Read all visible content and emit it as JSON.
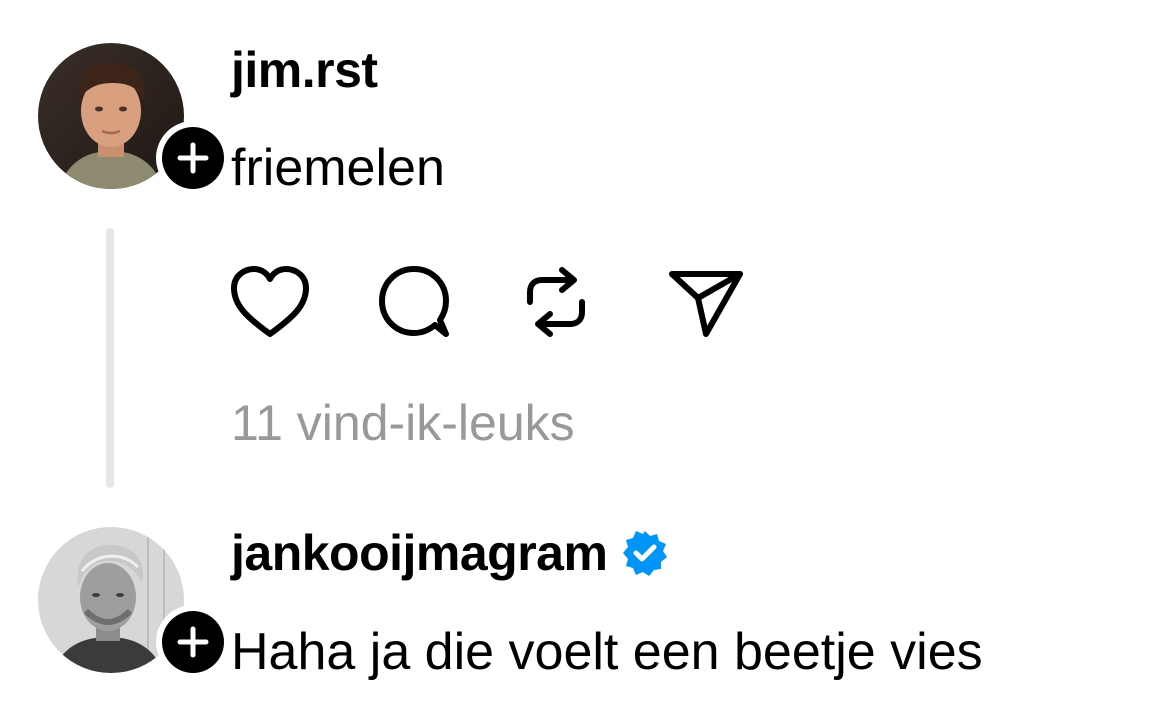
{
  "posts": [
    {
      "username": "jim.rst",
      "text": "friemelen",
      "avatar_icon": "profile-photo-young-man",
      "follow_icon": "plus-icon",
      "actions": [
        {
          "name": "like",
          "icon": "heart-icon"
        },
        {
          "name": "reply",
          "icon": "comment-icon"
        },
        {
          "name": "repost",
          "icon": "repost-icon"
        },
        {
          "name": "share",
          "icon": "send-icon"
        }
      ],
      "likes": "11 vind-ik-leuks"
    },
    {
      "username": "jankooijmagram",
      "verified": true,
      "verified_icon": "verified-badge-icon",
      "text": "Haha ja die voelt een beetje vies",
      "avatar_icon": "profile-photo-grey-man",
      "follow_icon": "plus-icon"
    }
  ],
  "colors": {
    "text": "#000000",
    "muted": "#999999",
    "thread_line": "#e6e6e6",
    "verified": "#0095f6"
  }
}
